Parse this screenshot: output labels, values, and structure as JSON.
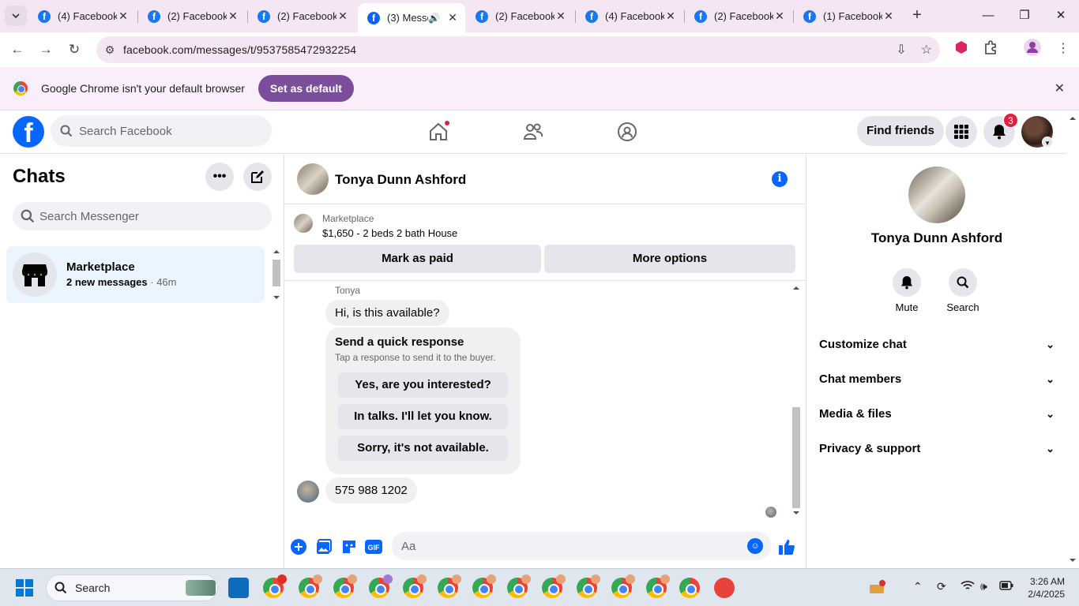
{
  "browser": {
    "tabs": [
      {
        "title": "(4) Facebook",
        "active": false
      },
      {
        "title": "(2) Facebook",
        "active": false
      },
      {
        "title": "(2) Facebook",
        "active": false
      },
      {
        "title": "(3) Messe",
        "active": true
      },
      {
        "title": "(2) Facebook",
        "active": false
      },
      {
        "title": "(4) Facebook",
        "active": false
      },
      {
        "title": "(2) Facebook",
        "active": false
      },
      {
        "title": "(1) Facebook",
        "active": false
      }
    ],
    "url": "facebook.com/messages/t/9537585472932254",
    "infobar": {
      "text": "Google Chrome isn't your default browser",
      "button": "Set as default"
    }
  },
  "facebook": {
    "search_placeholder": "Search Facebook",
    "find_friends": "Find friends",
    "notification_count": "3"
  },
  "chats": {
    "title": "Chats",
    "search_placeholder": "Search Messenger",
    "items": [
      {
        "name": "Marketplace",
        "subtitle": "2 new messages",
        "time": "46m"
      }
    ]
  },
  "conversation": {
    "contact_name": "Tonya Dunn Ashford",
    "marketplace_label": "Marketplace",
    "listing": "$1,650 - 2 beds 2 bath House",
    "mark_paid": "Mark as paid",
    "more_options": "More options",
    "sender": "Tonya",
    "messages": {
      "first": "Hi, is this available?",
      "last": "575 988 1202"
    },
    "quick_response": {
      "title": "Send a quick response",
      "subtitle": "Tap a response to send it to the buyer.",
      "options": [
        "Yes, are you interested?",
        "In talks. I'll let you know.",
        "Sorry, it's not available."
      ]
    },
    "composer_placeholder": "Aa"
  },
  "details": {
    "name": "Tonya Dunn Ashford",
    "actions": [
      "Mute",
      "Search"
    ],
    "sections": [
      "Customize chat",
      "Chat members",
      "Media & files",
      "Privacy & support"
    ]
  },
  "taskbar": {
    "search_placeholder": "Search",
    "time": "3:26 AM",
    "date": "2/4/2025"
  },
  "colors": {
    "facebook_blue": "#0866ff",
    "chrome_tabstrip": "#f4e7f3",
    "set_default_button": "#7b4e9b",
    "notification_red": "#e41e3f"
  }
}
